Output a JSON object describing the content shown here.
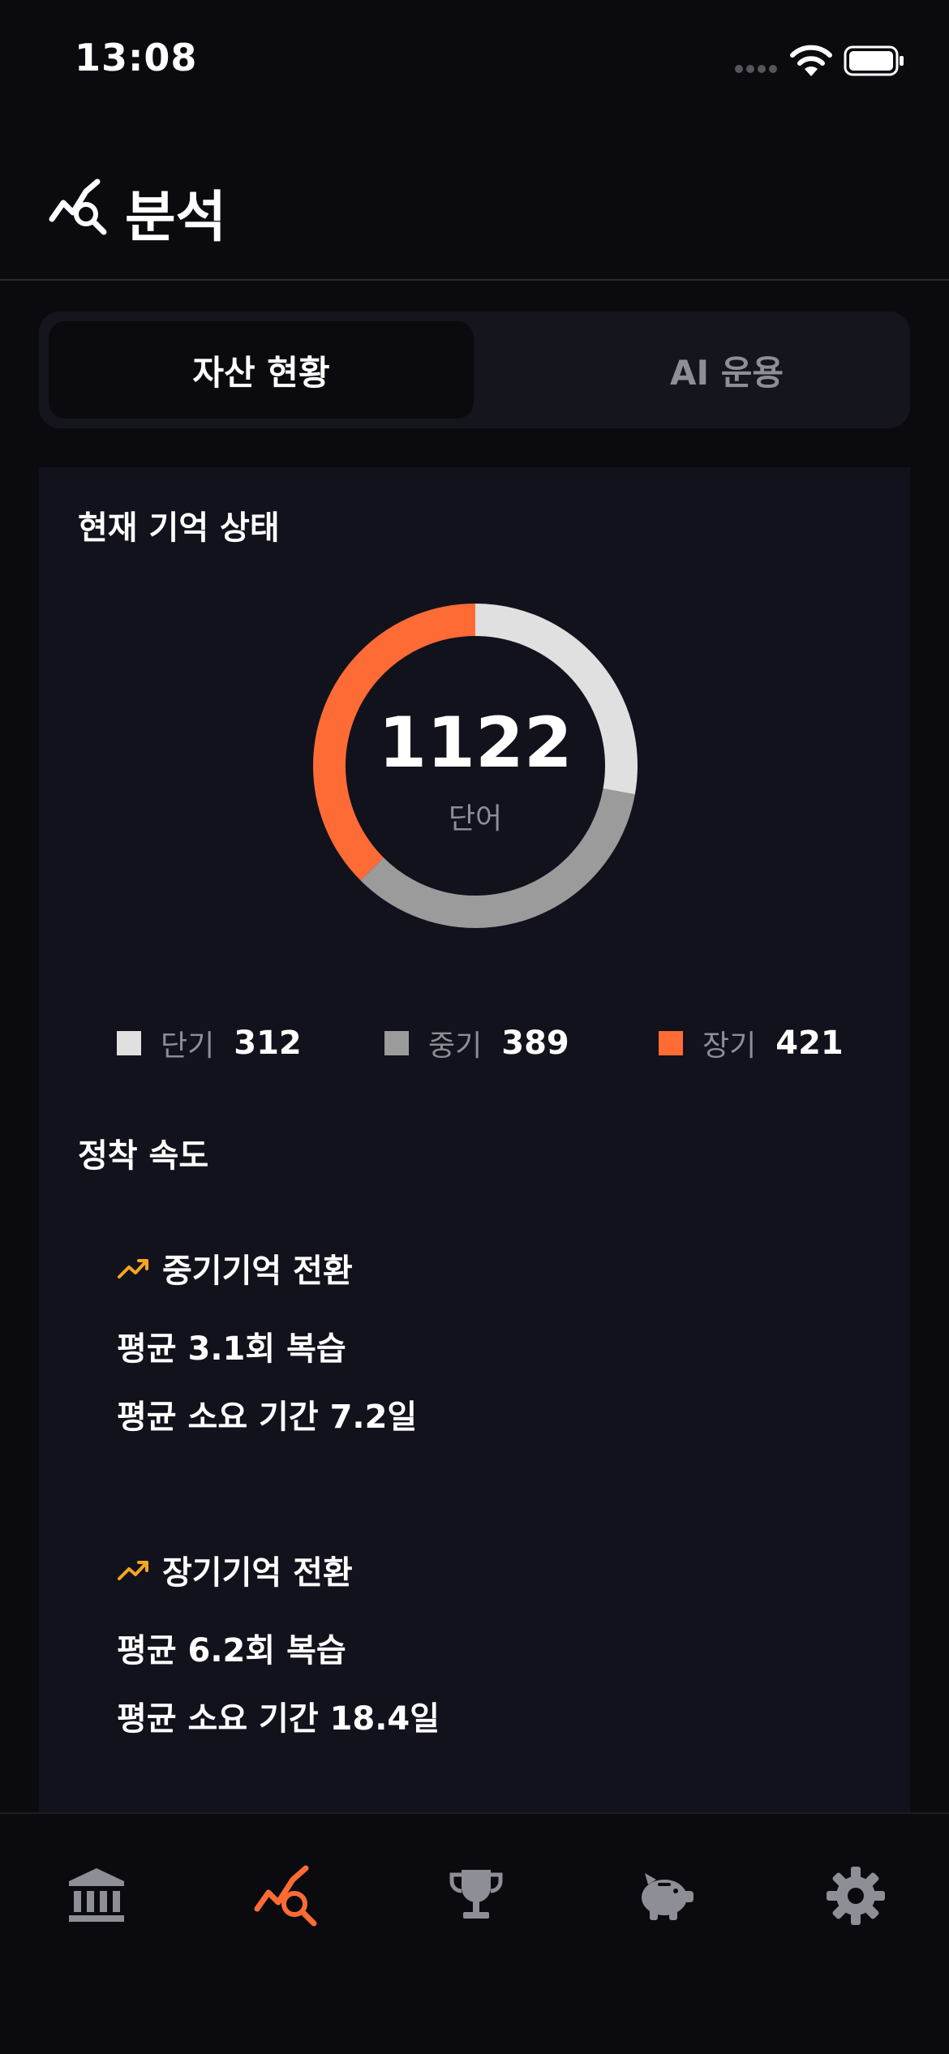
{
  "status_bar": {
    "time": "13:08"
  },
  "header": {
    "title": "분석"
  },
  "tabs": [
    {
      "label": "자산 현황",
      "active": true
    },
    {
      "label": "AI 운용",
      "active": false
    }
  ],
  "memory_state": {
    "title": "현재 기억 상태",
    "total": "1122",
    "unit": "단어",
    "legend": [
      {
        "label": "단기",
        "value": "312",
        "color": "#e0e0e0"
      },
      {
        "label": "중기",
        "value": "389",
        "color": "#9b9b9b"
      },
      {
        "label": "장기",
        "value": "421",
        "color": "#ff6b35"
      }
    ]
  },
  "settle_speed": {
    "title": "정착 속도",
    "mid": {
      "title": "중기기억 전환",
      "line1": "평균 3.1회 복습",
      "line2": "평균 소요 기간 7.2일"
    },
    "long": {
      "title": "장기기억 전환",
      "line1": "평균 6.2회 복습",
      "line2": "평균 소요 기간 18.4일"
    }
  },
  "colors": {
    "accent": "#ff6b35",
    "trend": "#f5a623",
    "inactive_icon": "#8e8e96"
  },
  "bottom_tabs": [
    {
      "icon": "bank-icon",
      "active": false
    },
    {
      "icon": "analysis-icon",
      "active": true
    },
    {
      "icon": "trophy-icon",
      "active": false
    },
    {
      "icon": "piggy-bank-icon",
      "active": false
    },
    {
      "icon": "gear-icon",
      "active": false
    }
  ]
}
